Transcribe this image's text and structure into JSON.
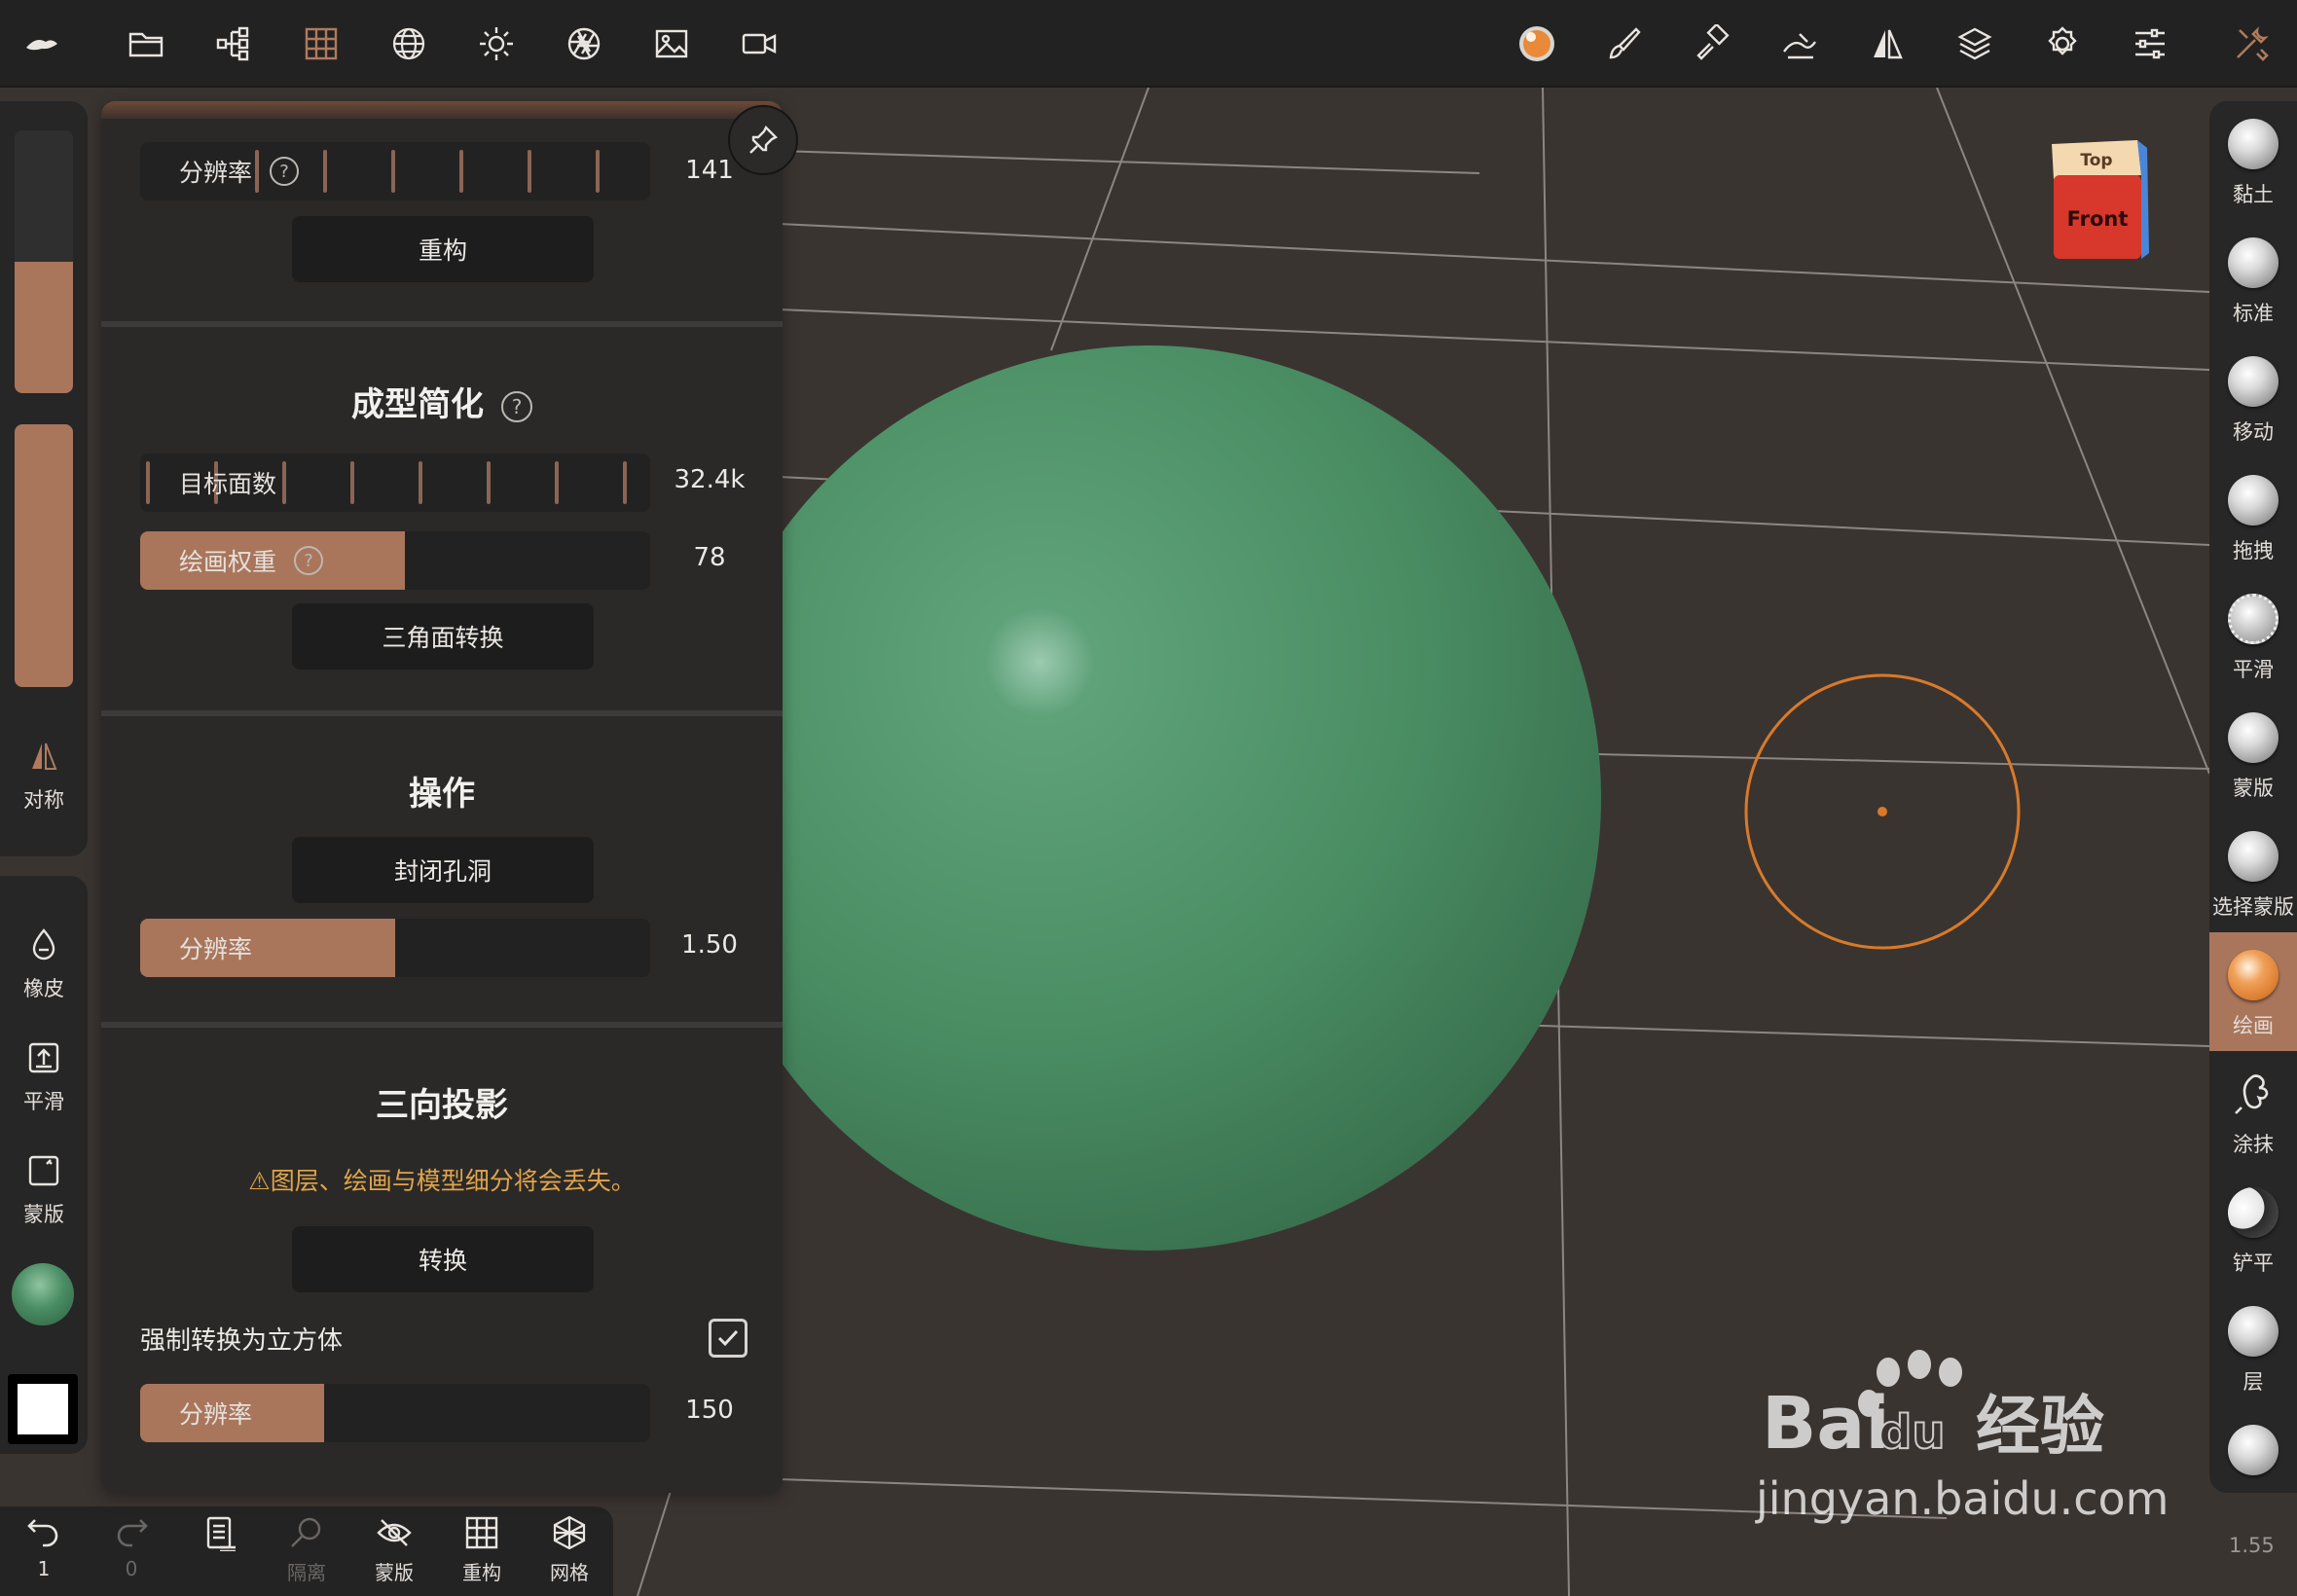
{
  "colors": {
    "accent": "#a9765c",
    "sphere": "#3f8a5c",
    "brush_ring": "#d87a2a",
    "warning": "#e0a44a",
    "cube_front": "#d8372b",
    "cube_top": "#f3d8b0",
    "cube_side": "#4a86d8"
  },
  "top_toolbar": {
    "left_icons": [
      "app-logo-icon",
      "folder-icon",
      "scene-tree-icon",
      "grid-icon",
      "sphere-wire-icon",
      "sun-icon",
      "aperture-icon",
      "image-icon",
      "video-icon"
    ],
    "right_icons": [
      "material-ball-icon",
      "brush-icon",
      "paint-icon",
      "stroke-icon",
      "symmetry-icon",
      "layers-icon",
      "gear-icon",
      "sliders-icon",
      "tools-icon"
    ]
  },
  "left_panel": {
    "symmetry_label": "对称",
    "tools": [
      {
        "icon": "drop-icon",
        "label": "橡皮"
      },
      {
        "icon": "upload-box-icon",
        "label": "平滑"
      },
      {
        "icon": "mask-box-icon",
        "label": "蒙版"
      }
    ],
    "slider_top_level": 0.5,
    "slider_bottom_level": 1.0
  },
  "bottom_toolbar": {
    "undo_count": "1",
    "redo_count": "0",
    "items": [
      {
        "icon": "notebook-icon",
        "label": ""
      },
      {
        "icon": "search-icon",
        "label": "隔离"
      },
      {
        "icon": "eye-slash-icon",
        "label": "蒙版"
      },
      {
        "icon": "grid-icon",
        "label": "重构"
      },
      {
        "icon": "mesh-icon",
        "label": "网格"
      }
    ]
  },
  "panel": {
    "remesh": {
      "resolution_label": "分辨率",
      "resolution_value": "141",
      "button": "重构"
    },
    "decimate": {
      "title": "成型简化",
      "target_label": "目标面数",
      "target_value": "32.4k",
      "paint_weight_label": "绘画权重",
      "paint_weight_value": "78",
      "paint_weight_level": 0.52,
      "button": "三角面转换"
    },
    "operations": {
      "title": "操作",
      "button": "封闭孔洞",
      "resolution_label": "分辨率",
      "resolution_value": "1.50",
      "resolution_level": 0.5
    },
    "triplanar": {
      "title": "三向投影",
      "warning": "图层、绘画与模型细分将会丢失。",
      "button": "转换",
      "force_cube_label": "强制转换为立方体",
      "force_cube_checked": true,
      "resolution_label": "分辨率",
      "resolution_value": "150",
      "resolution_level": 0.36
    }
  },
  "right_tools": [
    {
      "label": "黏土",
      "active": false
    },
    {
      "label": "标准",
      "active": false
    },
    {
      "label": "移动",
      "active": false
    },
    {
      "label": "拖拽",
      "active": false
    },
    {
      "label": "平滑",
      "active": false
    },
    {
      "label": "蒙版",
      "active": false
    },
    {
      "label": "选择蒙版",
      "active": false
    },
    {
      "label": "绘画",
      "active": true
    },
    {
      "label": "涂抹",
      "active": false
    },
    {
      "label": "铲平",
      "active": false
    },
    {
      "label": "层",
      "active": false
    }
  ],
  "navcube": {
    "top": "Top",
    "front": "Front"
  },
  "zoom": "1.55",
  "watermark": {
    "brand": "Bai",
    "brand_du": "du",
    "brand_cn": "经验",
    "url": "jingyan.baidu.com"
  }
}
